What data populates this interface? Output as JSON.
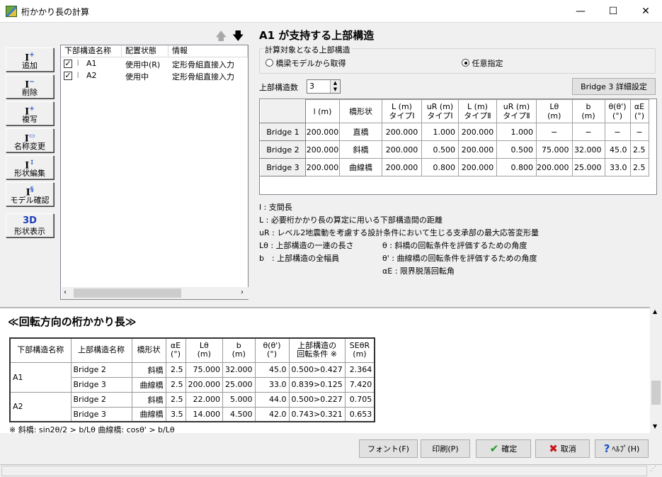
{
  "window": {
    "title": "桁かかり長の計算"
  },
  "toolbar": [
    {
      "icon": "I",
      "plus": "+",
      "label": "追加"
    },
    {
      "icon": "I",
      "plus": "−",
      "label": "削除"
    },
    {
      "icon": "I",
      "plus": "+",
      "label": "複写"
    },
    {
      "icon": "I",
      "plus": "▭",
      "label": "名称変更"
    },
    {
      "icon": "I",
      "plus": "↕",
      "label": "形状編集"
    },
    {
      "icon": "I",
      "plus": "§",
      "label": "モデル確認"
    },
    {
      "icon": "3D",
      "plus": "",
      "label": "形状表示"
    }
  ],
  "list": {
    "headers": [
      "下部構造名称",
      "配置状態",
      "情報"
    ],
    "rows": [
      {
        "name": "A1",
        "status": "使用中(R)",
        "info": "定形骨組直接入力"
      },
      {
        "name": "A2",
        "status": "使用中",
        "info": "定形骨組直接入力"
      }
    ]
  },
  "panel": {
    "title": "A1 が支持する上部構造",
    "group_label": "計算対象となる上部構造",
    "radio1": "橋梁モデルから取得",
    "radio2": "任意指定",
    "count_label": "上部構造数",
    "count_value": "3",
    "detail_button": "Bridge 3 詳細設定"
  },
  "grid": {
    "headers": [
      "l (m)",
      "橋形状",
      "L (m)\nタイプⅠ",
      "uR (m)\nタイプⅠ",
      "L (m)\nタイプⅡ",
      "uR (m)\nタイプⅡ",
      "Lθ\n(m)",
      "b\n(m)",
      "θ(θ')\n(°)",
      "αE\n(°)"
    ],
    "rows": [
      [
        "Bridge 1",
        "200.000",
        "直橋",
        "200.000",
        "1.000",
        "200.000",
        "1.000",
        "−",
        "−",
        "−",
        "−"
      ],
      [
        "Bridge 2",
        "200.000",
        "斜橋",
        "200.000",
        "0.500",
        "200.000",
        "0.500",
        "75.000",
        "32.000",
        "45.0",
        "2.5"
      ],
      [
        "Bridge 3",
        "200.000",
        "曲線橋",
        "200.000",
        "0.800",
        "200.000",
        "0.800",
        "200.000",
        "25.000",
        "33.0",
        "2.5"
      ]
    ]
  },
  "notes": {
    "n1": "l : 支間長",
    "n2": "L : 必要桁かかり長の算定に用いる下部構造間の距離",
    "n3": "uR : レベル2地震動を考慮する設計条件において生じる支承部の最大応答変形量",
    "n4a": "Lθ : 上部構造の一連の長さ",
    "n4b": "θ : 斜橋の回転条件を評価するための角度",
    "n5a": "b　: 上部構造の全幅員",
    "n5b": "θ' : 曲線橋の回転条件を評価するための角度",
    "n6": "αE : 限界脱落回転角"
  },
  "report": {
    "title": "≪回転方向の桁かかり長≫",
    "headers": [
      "下部構造名称",
      "上部構造名称",
      "橋形状",
      "αE\n(°)",
      "Lθ\n(m)",
      "b\n(m)",
      "θ(θ')\n(°)",
      "上部構造の\n回転条件 ※",
      "SEθR\n(m)"
    ],
    "groups": [
      {
        "pier": "A1",
        "rows": [
          [
            "Bridge 2",
            "斜橋",
            "2.5",
            "75.000",
            "32.000",
            "45.0",
            "0.500>0.427",
            "2.364"
          ],
          [
            "Bridge 3",
            "曲線橋",
            "2.5",
            "200.000",
            "25.000",
            "33.0",
            "0.839>0.125",
            "7.420"
          ]
        ]
      },
      {
        "pier": "A2",
        "rows": [
          [
            "Bridge 2",
            "斜橋",
            "2.5",
            "22.000",
            "5.000",
            "44.0",
            "0.500>0.227",
            "0.705"
          ],
          [
            "Bridge 3",
            "曲線橋",
            "3.5",
            "14.000",
            "4.500",
            "42.0",
            "0.743>0.321",
            "0.653"
          ]
        ]
      }
    ],
    "formula": "※ 斜橋: sin2θ/2 > b/Lθ 曲線橋: cosθ' > b/Lθ"
  },
  "buttons": {
    "font": "フォント(F)",
    "print": "印刷(P)",
    "ok": "確定",
    "cancel": "取消",
    "help": "ﾍﾙﾌﾟ(H)"
  },
  "colors": {
    "ok_check": "#1c9a2a",
    "cancel_x": "#c8171c",
    "help_q": "#1a52c6"
  }
}
